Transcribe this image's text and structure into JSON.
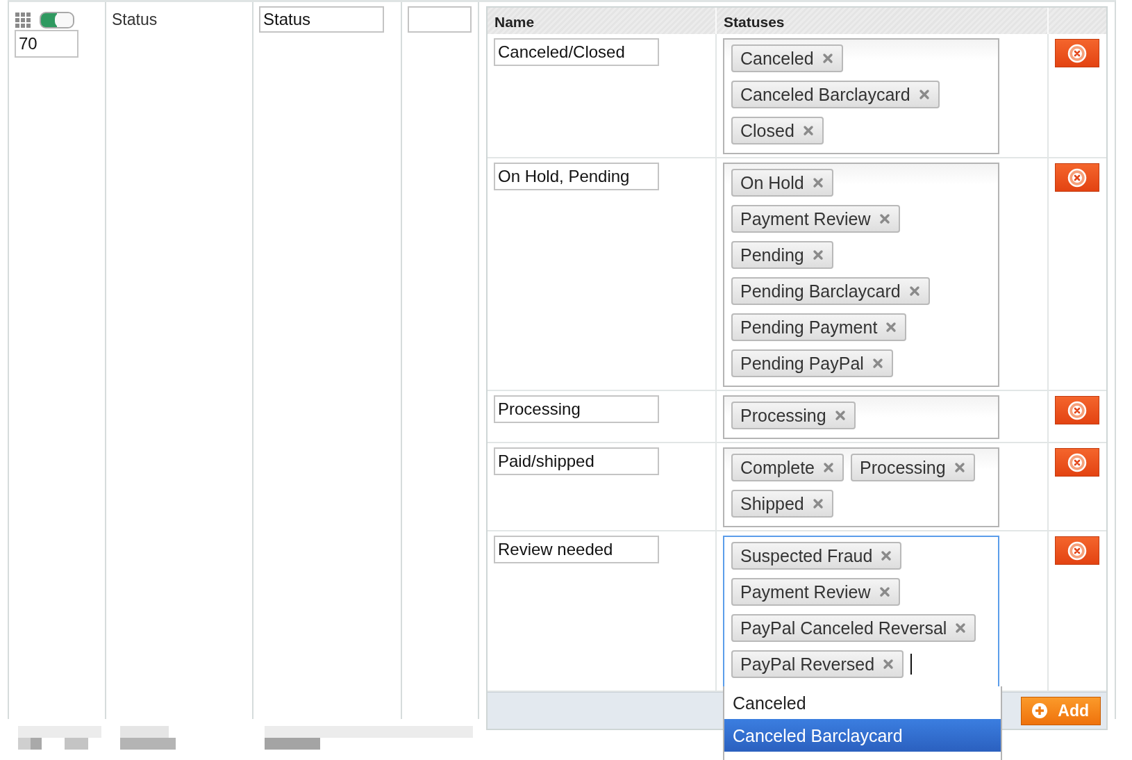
{
  "attribute_row": {
    "enabled": true,
    "sort_order": "70",
    "label": "Status",
    "field_value": "Status"
  },
  "mapping_table": {
    "columns": [
      "Name",
      "Statuses"
    ],
    "groups": [
      {
        "name": "Canceled/Closed",
        "focused": false,
        "statuses": [
          "Canceled",
          "Canceled Barclaycard",
          "Closed"
        ]
      },
      {
        "name": "On Hold, Pending",
        "focused": false,
        "statuses": [
          "On Hold",
          "Payment Review",
          "Pending",
          "Pending Barclaycard",
          "Pending Payment",
          "Pending PayPal"
        ]
      },
      {
        "name": "Processing",
        "focused": false,
        "statuses": [
          "Processing"
        ]
      },
      {
        "name": "Paid/shipped",
        "focused": false,
        "statuses": [
          "Complete",
          "Processing",
          "Shipped"
        ]
      },
      {
        "name": "Review needed",
        "focused": true,
        "statuses": [
          "Suspected Fraud",
          "Payment Review",
          "PayPal Canceled Reversal",
          "PayPal Reversed"
        ]
      }
    ],
    "dropdown": [
      {
        "label": "Canceled",
        "selected": false
      },
      {
        "label": "Canceled Barclaycard",
        "selected": true
      }
    ],
    "add_button": "Add"
  }
}
